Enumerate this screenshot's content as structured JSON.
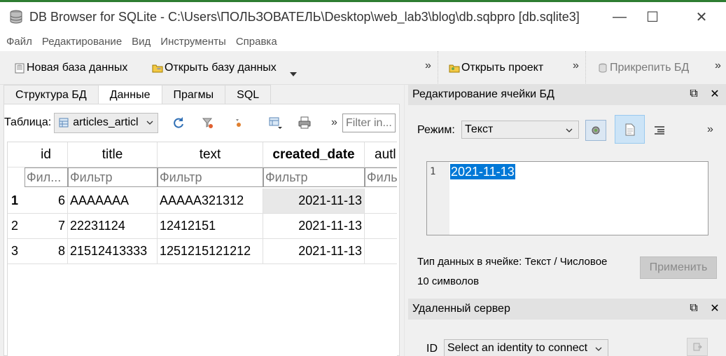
{
  "window": {
    "title": "DB Browser for SQLite - C:\\Users\\ПОЛЬЗОВАТЕЛЬ\\Desktop\\web_lab3\\blog\\db.sqbpro [db.sqlite3]",
    "minimize": "—",
    "maximize": "☐",
    "close": "✕"
  },
  "menu": [
    "Файл",
    "Редактирование",
    "Вид",
    "Инструменты",
    "Справка"
  ],
  "toolbar": {
    "new_db": "Новая база данных",
    "open_db": "Открыть базу данных",
    "open_project": "Открыть проект",
    "attach_db": "Прикрепить БД",
    "overflow": "»"
  },
  "tabs": [
    "Структура БД",
    "Данные",
    "Прагмы",
    "SQL"
  ],
  "active_tab": "Данные",
  "browse": {
    "table_label": "Таблица:",
    "table_value": "articles_articl",
    "filter_placeholder": "Filter in...",
    "overflow": "»"
  },
  "grid": {
    "columns": [
      "id",
      "title",
      "text",
      "created_date",
      "autl"
    ],
    "sorted_column": "created_date",
    "filters": [
      "Фил...",
      "Фильтр",
      "Фильтр",
      "Фильтр",
      "Филь"
    ],
    "rows": [
      {
        "num": "1",
        "id": "6",
        "title": "AAAAAAA",
        "text": "AAAAA321312",
        "created_date": "2021-11-13",
        "author": ""
      },
      {
        "num": "2",
        "id": "7",
        "title": "22231124",
        "text": "12412151",
        "created_date": "2021-11-13",
        "author": ""
      },
      {
        "num": "3",
        "id": "8",
        "title": "21512413333",
        "text": "1251215121212",
        "created_date": "2021-11-13",
        "author": ""
      }
    ],
    "selected_row": 0
  },
  "edit_cell": {
    "header": "Редактирование ячейки БД",
    "mode_label": "Режим:",
    "mode_value": "Текст",
    "overflow": "»",
    "line_number": "1",
    "content": "2021-11-13",
    "type_info": "Тип данных в ячейке: Текст / Числовое",
    "length_info": "10 символов",
    "apply": "Применить"
  },
  "remote": {
    "header": "Удаленный сервер",
    "id_label": "ID",
    "identity_value": "Select an identity to connect"
  },
  "dock_controls": {
    "float": "⧉",
    "close": "✕"
  },
  "colors": {
    "selection": "#0078d7",
    "panel_header": "#e2e2e2",
    "active_toggle": "#cce4f7"
  }
}
